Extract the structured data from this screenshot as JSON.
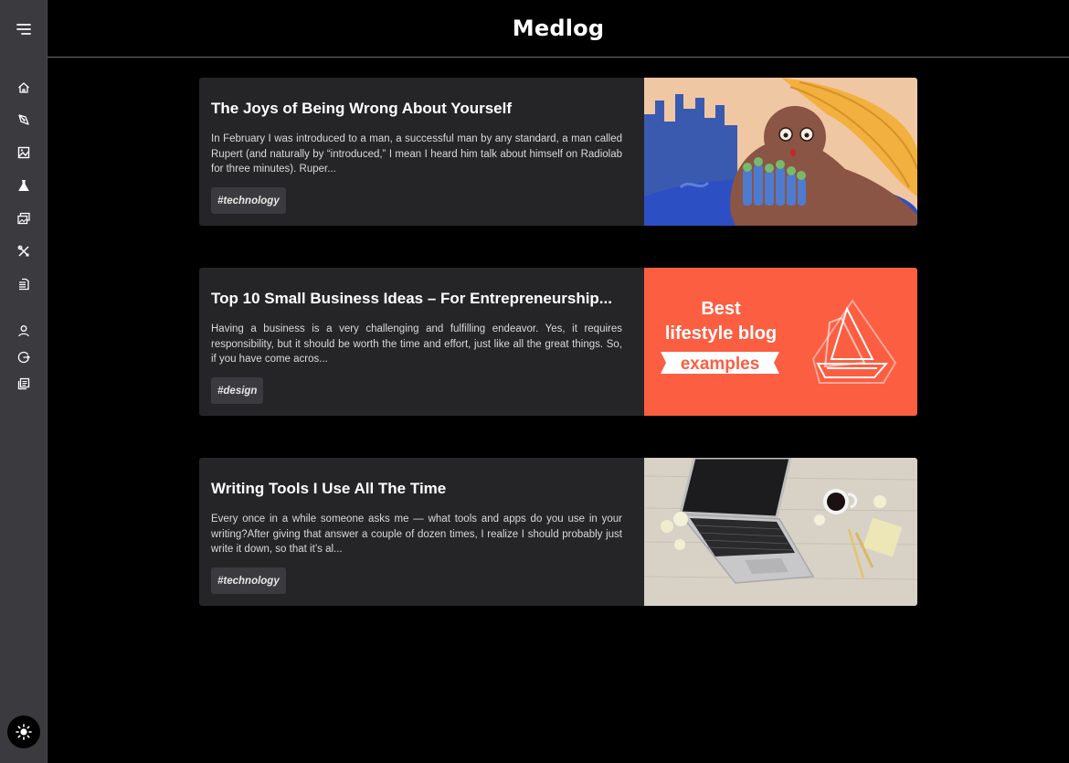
{
  "app": {
    "title": "Medlog"
  },
  "sidebar": {
    "menu_icon": "menu-icon",
    "items": [
      {
        "name": "home",
        "icon": "home-icon"
      },
      {
        "name": "write",
        "icon": "pen-icon"
      },
      {
        "name": "gallery",
        "icon": "image-icon"
      },
      {
        "name": "science",
        "icon": "flask-icon"
      },
      {
        "name": "media",
        "icon": "photos-icon"
      },
      {
        "name": "tools",
        "icon": "tools-icon"
      },
      {
        "name": "documents",
        "icon": "docs-icon"
      },
      {
        "name": "account",
        "icon": "user-icon"
      },
      {
        "name": "logout",
        "icon": "logout-icon"
      },
      {
        "name": "collections",
        "icon": "collection-icon"
      }
    ],
    "theme_icon": "sun-icon"
  },
  "posts": [
    {
      "title": "The Joys of Being Wrong About Yourself",
      "excerpt": "In February I was introduced to a man, a successful man by any standard, a man called Rupert (and naturally by “introduced,” I mean I heard him talk about himself on Radiolab for three minutes). Ruper...",
      "tag": "#technology",
      "image": "illustration-city-woman"
    },
    {
      "title": "Top 10 Small Business Ideas – For Entrepreneurship...",
      "excerpt": "Having a business is a very challenging and fulfilling endeavor. Yes, it requires responsibility, but it should be worth the time and effort, just like all the great things. So, if you have come acros...",
      "tag": "#design",
      "image": "best-lifestyle-blog-banner",
      "image_text": {
        "line1": "Best",
        "line2": "lifestyle blog",
        "line3": "examples"
      }
    },
    {
      "title": "Writing Tools I Use All The Time",
      "excerpt": "Every once in a while someone asks me — what tools and apps do you use in your writing?After giving that answer a couple of dozen times, I realize I should probably just write it down, so that it’s al...",
      "tag": "#technology",
      "image": "laptop-desk-photo"
    }
  ],
  "colors": {
    "background": "#000000",
    "sidebar": "#3b3b3f",
    "card": "#252528",
    "tag_bg": "#3b3b3f",
    "banner_orange": "#fc5e42"
  }
}
